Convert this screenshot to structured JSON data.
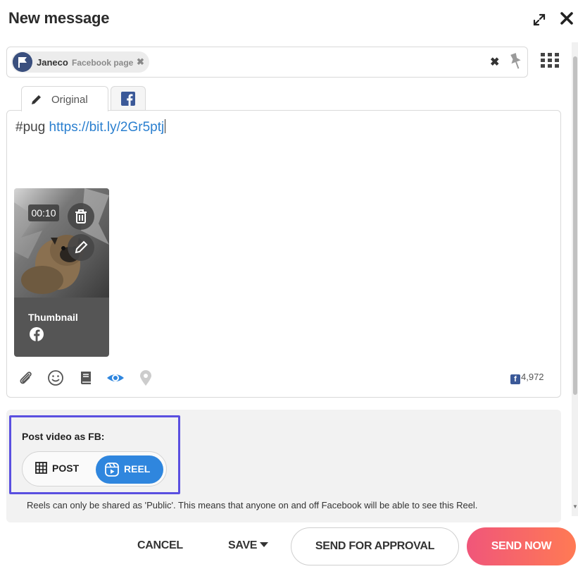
{
  "dialog": {
    "title": "New message"
  },
  "profiles": {
    "selected": [
      {
        "name": "Janeco",
        "type": "Facebook page"
      }
    ],
    "remove_glyph": "✖",
    "clear_glyph": "✖"
  },
  "tabs": [
    {
      "label": "Original",
      "icon": "pencil-icon",
      "active": true
    },
    {
      "label": "",
      "icon": "facebook-icon",
      "active": false
    }
  ],
  "editor": {
    "hashtag": "#pug ",
    "link": "https://bit.ly/2Gr5ptj"
  },
  "media": {
    "duration": "00:10",
    "thumbnail_label": "Thumbnail",
    "network_icon": "facebook-icon"
  },
  "toolbar": {
    "icons": [
      "attachment-icon",
      "emoji-icon",
      "library-icon",
      "preview-eye-icon",
      "location-icon"
    ],
    "active_color": "#2f86de",
    "fb_char_count": "4,972"
  },
  "video_options": {
    "label": "Post video as FB:",
    "options": [
      {
        "label": "POST",
        "icon": "grid-icon",
        "selected": false
      },
      {
        "label": "REEL",
        "icon": "reel-icon",
        "selected": true
      }
    ],
    "note": "Reels can only be shared as 'Public'. This means that anyone on and off Facebook will be able to see this Reel."
  },
  "footer": {
    "cancel": "CANCEL",
    "save": "SAVE",
    "send_for_approval": "SEND FOR APPROVAL",
    "send_now": "SEND NOW"
  },
  "colors": {
    "accent": "#2f86de",
    "highlight": "#5a4fe0",
    "send_gradient_start": "#f0567a",
    "send_gradient_end": "#ff7a54"
  }
}
